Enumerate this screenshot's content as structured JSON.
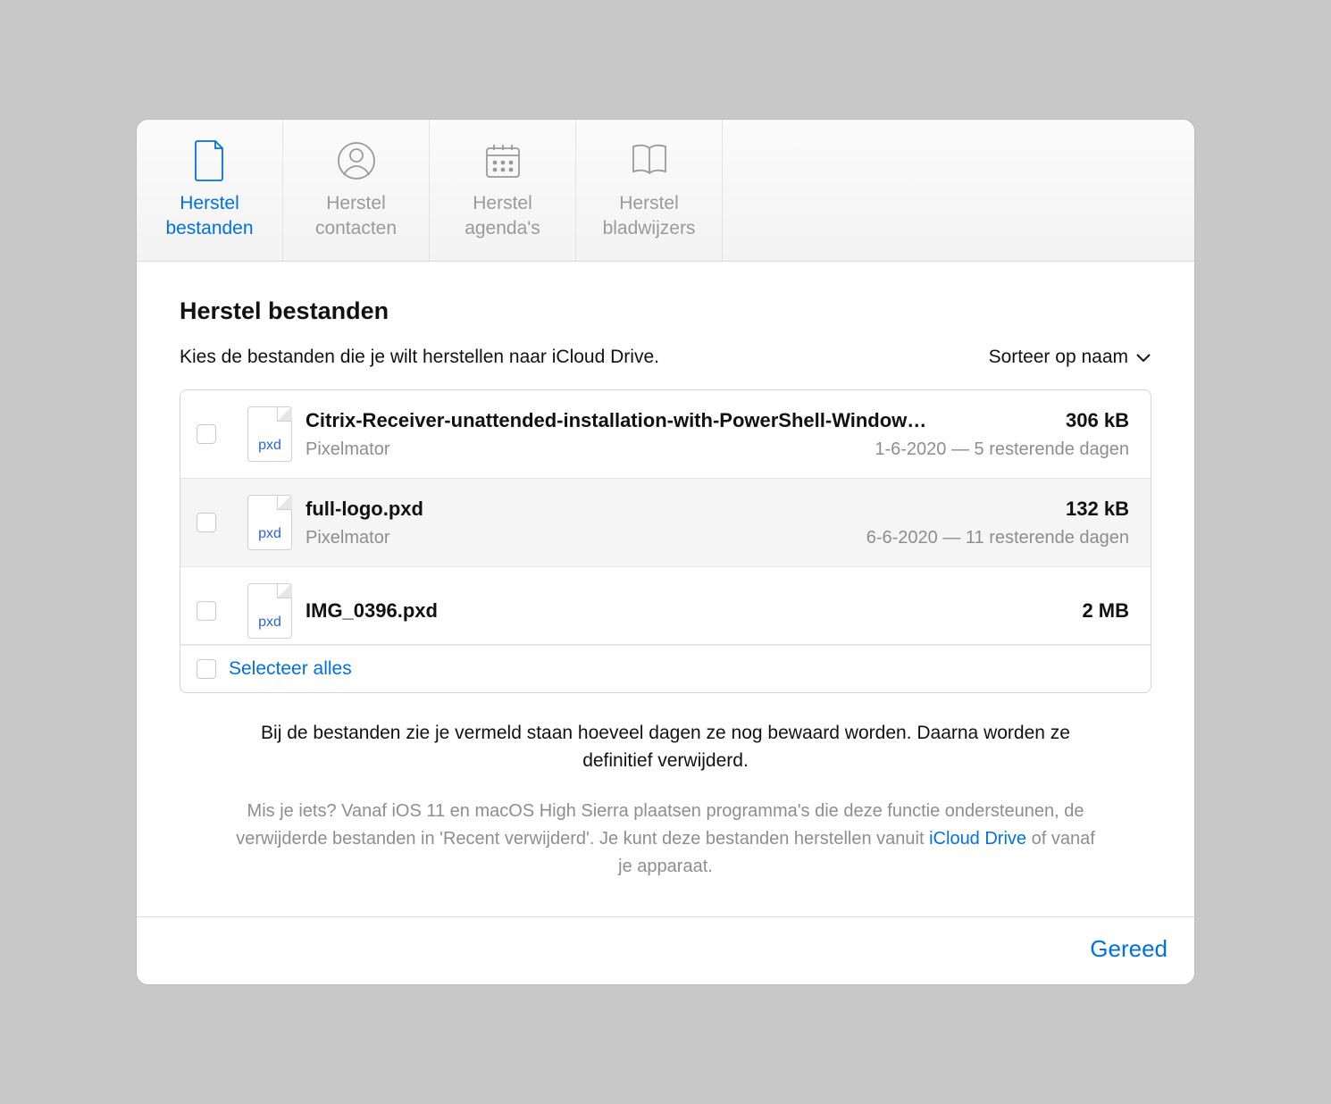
{
  "tabs": [
    {
      "label": "Herstel\nbestanden",
      "icon": "file-icon",
      "active": true
    },
    {
      "label": "Herstel\ncontacten",
      "icon": "contact-icon",
      "active": false
    },
    {
      "label": "Herstel\nagenda's",
      "icon": "calendar-icon",
      "active": false
    },
    {
      "label": "Herstel\nbladwijzers",
      "icon": "book-icon",
      "active": false
    }
  ],
  "main": {
    "title": "Herstel bestanden",
    "subtitle": "Kies de bestanden die je wilt herstellen naar iCloud Drive.",
    "sort_label": "Sorteer op naam"
  },
  "files": [
    {
      "name": "Citrix-Receiver-unattended-installation-with-PowerShell-Window…",
      "size": "306 kB",
      "app": "Pixelmator",
      "meta": "1-6-2020 — 5 resterende dagen",
      "ext": "pxd"
    },
    {
      "name": "full-logo.pxd",
      "size": "132 kB",
      "app": "Pixelmator",
      "meta": "6-6-2020 — 11 resterende dagen",
      "ext": "pxd"
    },
    {
      "name": "IMG_0396.pxd",
      "size": "2 MB",
      "app": "",
      "meta": "",
      "ext": "pxd"
    }
  ],
  "select_all_label": "Selecteer alles",
  "info": {
    "main": "Bij de bestanden zie je vermeld staan hoeveel dagen ze nog bewaard worden. Daarna worden ze definitief verwijderd.",
    "secondary_pre": "Mis je iets? Vanaf iOS 11 en macOS High Sierra plaatsen programma's die deze functie ondersteunen, de verwijderde bestanden in 'Recent verwijderd'. Je kunt deze bestanden herstellen vanuit ",
    "secondary_link": "iCloud Drive",
    "secondary_post": " of vanaf je apparaat."
  },
  "done_label": "Gereed"
}
